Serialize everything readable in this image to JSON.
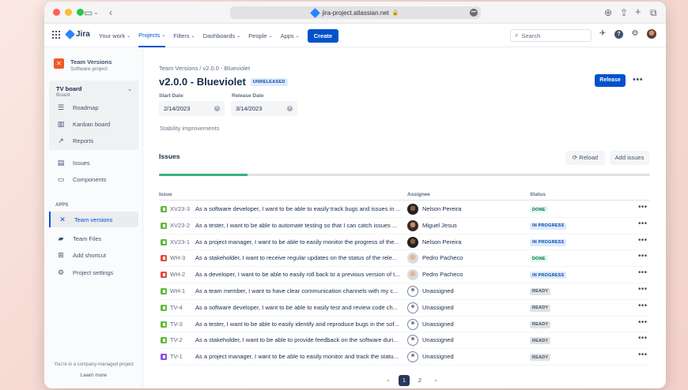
{
  "browser": {
    "url": "jira-project.atlassian.net"
  },
  "topnav": {
    "logo": "Jira",
    "links": [
      "Your work",
      "Projects",
      "Filters",
      "Dashboards",
      "People",
      "Apps"
    ],
    "create_label": "Create",
    "search_placeholder": "Search"
  },
  "sidebar": {
    "project_name": "Team Versions",
    "project_type": "Software project",
    "board_title": "TV board",
    "board_sub": "Board",
    "board_items": [
      "Roadmap",
      "Kanban board",
      "Reports"
    ],
    "items": [
      "Issues",
      "Components"
    ],
    "apps_label": "APPS",
    "app_items": [
      "Team versions",
      "Team Files",
      "Add shortcut",
      "Project settings"
    ],
    "footer_note": "You're in a company-managed project",
    "footer_link": "Learn more"
  },
  "main": {
    "breadcrumb": "Team Versions  /  v2.0.0 - Blueviolet",
    "title": "v2.0.0 - Blueviolet",
    "badge": "UNRELEASED",
    "release_label": "Release",
    "start_label": "Start Date",
    "start_value": "2/14/2023",
    "release_date_label": "Release Date",
    "release_date_value": "3/14/2023",
    "description": "Stability improvements",
    "issues_heading": "Issues",
    "reload_label": "Reload",
    "add_issues_label": "Add issues",
    "progress": 0.18,
    "columns": [
      "Issue",
      "Assignee",
      "Status"
    ],
    "pages": [
      "1",
      "2"
    ],
    "current_page": "1"
  },
  "issues": [
    {
      "type": "story",
      "key": "XV23-3",
      "summary": "As a software developer, I want to be able to easily track bugs and issues in ...",
      "assignee": "Nelson Pereira",
      "avatar": "p-nelson",
      "status": "DONE",
      "status_class": "done"
    },
    {
      "type": "story",
      "key": "XV23-2",
      "summary": "As a tester, I want to be able to automate testing so that I can catch issues ...",
      "assignee": "Miguel Jesus",
      "avatar": "p-miguel",
      "status": "IN PROGRESS",
      "status_class": "inprog"
    },
    {
      "type": "story",
      "key": "XV23-1",
      "summary": "As a project manager, I want to be able to easily monitor the progress of the...",
      "assignee": "Nelson Pereira",
      "avatar": "p-nelson",
      "status": "IN PROGRESS",
      "status_class": "inprog"
    },
    {
      "type": "bug",
      "key": "WH-3",
      "summary": "As a stakeholder, I want to receive regular updates on the status of the rele...",
      "assignee": "Pedro Pacheco",
      "avatar": "p-pedro",
      "status": "DONE",
      "status_class": "done"
    },
    {
      "type": "bug",
      "key": "WH-2",
      "summary": "As a developer, I want to be able to easily roll back to a previous version of t...",
      "assignee": "Pedro Pacheco",
      "avatar": "p-pedro",
      "status": "IN PROGRESS",
      "status_class": "inprog"
    },
    {
      "type": "story",
      "key": "WH-1",
      "summary": "As a team member, I want to have clear communication channels with my c...",
      "assignee": "Unassigned",
      "avatar": "p-none",
      "status": "READY",
      "status_class": "ready"
    },
    {
      "type": "story",
      "key": "TV-4",
      "summary": "As a software developer, I want to be able to easily test and review code ch...",
      "assignee": "Unassigned",
      "avatar": "p-none",
      "status": "READY",
      "status_class": "ready"
    },
    {
      "type": "story",
      "key": "TV-3",
      "summary": "As a tester, I want to be able to easily identify and reproduce bugs in the sof...",
      "assignee": "Unassigned",
      "avatar": "p-none",
      "status": "READY",
      "status_class": "ready"
    },
    {
      "type": "story",
      "key": "TV-2",
      "summary": "As a stakeholder, I want to be able to provide feedback on the software duri...",
      "assignee": "Unassigned",
      "avatar": "p-none",
      "status": "READY",
      "status_class": "ready"
    },
    {
      "type": "epic",
      "key": "TV-1",
      "summary": "As a project manager, I want to be able to easily monitor and track the statu...",
      "assignee": "Unassigned",
      "avatar": "p-none",
      "status": "READY",
      "status_class": "ready"
    }
  ]
}
